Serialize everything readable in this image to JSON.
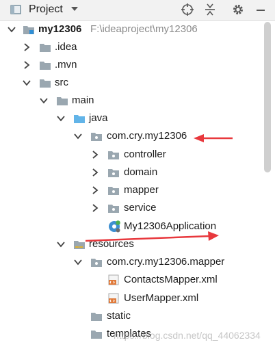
{
  "header": {
    "title": "Project",
    "icons": [
      "project-view-icon",
      "dropdown-arrow-icon",
      "locate-icon",
      "collapse-all-icon",
      "settings-gear-icon",
      "hide-minimize-icon"
    ]
  },
  "tree": {
    "root": {
      "name": "my12306",
      "path": "F:\\ideaproject\\my12306"
    },
    "items": {
      "idea": ".idea",
      "mvn": ".mvn",
      "src": "src",
      "main": "main",
      "java": "java",
      "pkg": "com.cry.my12306",
      "controller": "controller",
      "domain": "domain",
      "mapper": "mapper",
      "service": "service",
      "app": "My12306Application",
      "resources": "resources",
      "respkg": "com.cry.my12306.mapper",
      "contacts": "ContactsMapper.xml",
      "usermapper": "UserMapper.xml",
      "static": "static",
      "templates": "templates"
    }
  },
  "watermark": "https://blog.csdn.net/qq_44062334",
  "colors": {
    "header_bg": "#f2f2f2",
    "folder_gray": "#9aa7b0",
    "folder_blue": "#62b4e8",
    "arrow_red": "#e8383d",
    "xml_orange": "#e07a3a"
  }
}
